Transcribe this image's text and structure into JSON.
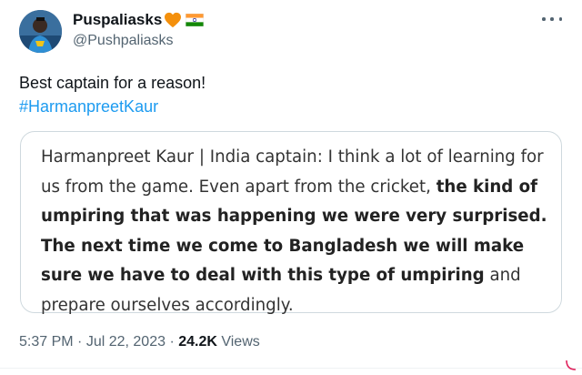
{
  "author": {
    "display_name": "Puspaliasks",
    "handle": "@Pushpaliasks",
    "avatar_icon": "profile-photo-icon",
    "badges": [
      "orange-heart-icon",
      "india-flag-icon"
    ]
  },
  "tweet": {
    "text_line1": "Best captain for a reason!",
    "hashtag": "#HarmanpreetKaur"
  },
  "quote": {
    "speaker": "Harmanpreet Kaur | India captain",
    "colon": ":",
    "seg1": " I think a lot of learning for us from the game. Even apart from the cricket, ",
    "seg2_bold": "the kind of umpiring that was happening we were very surprised. The next time we come to Bangladesh we will make sure we have to deal with this type of umpiring",
    "seg3": " and prepare ourselves accordingly."
  },
  "meta": {
    "time": "5:37 PM",
    "sep1": " · ",
    "date": "Jul 22, 2023",
    "sep2": " · ",
    "views_count": "24.2K",
    "views_label": " Views"
  },
  "colors": {
    "link": "#1d9bf0",
    "text": "#0f1419",
    "secondary": "#536471",
    "border": "#cfd9de"
  }
}
